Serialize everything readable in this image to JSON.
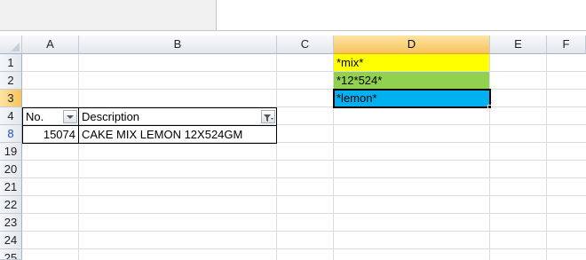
{
  "columns": [
    "A",
    "B",
    "C",
    "D",
    "E",
    "F"
  ],
  "selected_column": "D",
  "rows": [
    "1",
    "2",
    "3",
    "4",
    "8",
    "19",
    "20",
    "21",
    "22",
    "23",
    "24",
    "25"
  ],
  "criteria": {
    "d1": "*mix*",
    "d2": "*12*524*",
    "d3": "*lemon*"
  },
  "table": {
    "headers": [
      "No.",
      "Description"
    ],
    "row_8": {
      "no": "15074",
      "description": "CAKE MIX LEMON 12X524GM"
    }
  },
  "colors": {
    "d1_fill": "#ffff00",
    "d2_fill": "#92d050",
    "d3_fill": "#00b0f0",
    "selection_header": "#f6c35a",
    "filtered_row_number": "#1f4fbf"
  },
  "icons": {
    "header_a": "filter-dropdown-icon",
    "header_b": "filter-applied-icon"
  }
}
